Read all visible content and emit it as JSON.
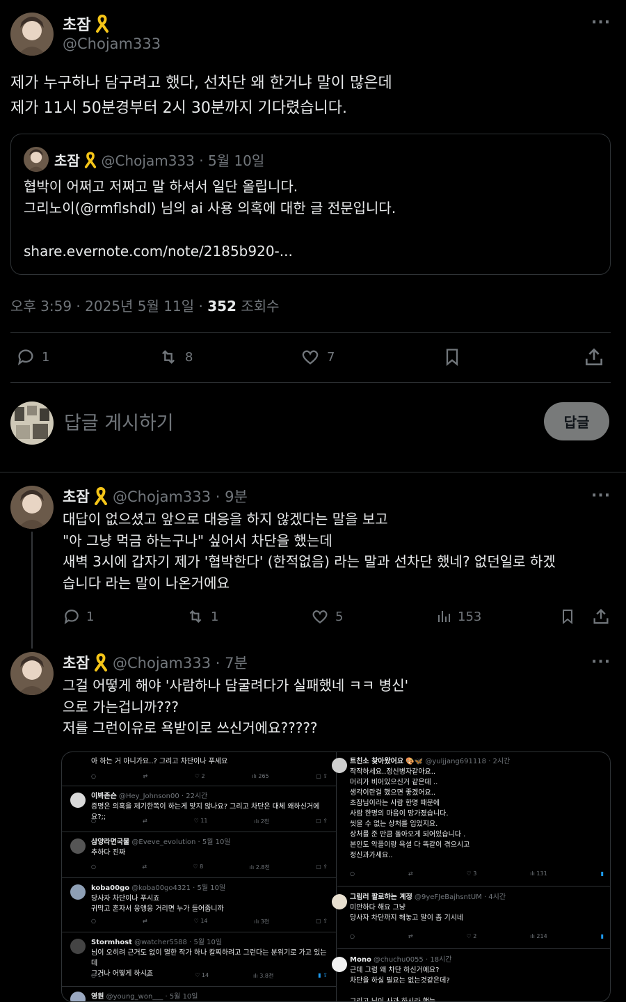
{
  "main_tweet": {
    "display_name": "초잠",
    "handle": "@Chojam333",
    "text_lines": [
      "제가 누구하나 담구려고 했다, 선차단 왜 한거냐 말이 많은데",
      "제가 11시 50분경부터 2시 30분까지 기다렸습니다."
    ],
    "quote": {
      "display_name": "초잠",
      "handle": "@Chojam333",
      "date": "· 5월 10일",
      "text_lines": [
        "협박이 어쩌고 저쩌고 말 하셔서 일단 올립니다.",
        "그리노이(@rmflshdl) 님의 ai 사용 의혹에 대한 글 전문입니다."
      ],
      "link": "share.evernote.com/note/2185b920-..."
    },
    "timestamp": "오후 3:59 · 2025년 5월 11일 ·",
    "views_count": "352",
    "views_label": "조회수",
    "stats": {
      "replies": "1",
      "reposts": "8",
      "likes": "7"
    }
  },
  "reply_box": {
    "placeholder": "답글 게시하기",
    "button": "답글"
  },
  "replies": [
    {
      "display_name": "초잠",
      "handle": "@Chojam333",
      "time": "· 9분",
      "text_lines": [
        "대답이 없으셨고 앞으로 대응을 하지 않겠다는 말을 보고",
        "\"아 그냥 먹금 하는구나\" 싶어서 차단을 했는데",
        "새벽 3시에 갑자기 제가 '협박한다' (한적없음)  라는 말과 선차단 했네? 없던일로 하겠",
        "습니다 라는 말이 나온거에요"
      ],
      "stats": {
        "replies": "1",
        "reposts": "1",
        "likes": "5",
        "views": "153"
      }
    },
    {
      "display_name": "초잠",
      "handle": "@Chojam333",
      "time": "· 7분",
      "text_lines": [
        "그걸 어떻게 해야 '사람하나 담굴려다가 실패했네 ㅋㅋ 병신'",
        "으로 가는겁니까???",
        "저를 그런이유로 욕받이로 쓰신거에요?????"
      ]
    }
  ],
  "embedded": {
    "left": [
      {
        "name": "",
        "handle": "",
        "lines": [
          "아 하는 거 아니가요..? 그리고 차단이나 푸세요"
        ],
        "likes": "2",
        "views": "265"
      },
      {
        "name": "이봐존슨",
        "handle": "@Hey_Johnson00 · 22시간",
        "lines": [
          "증명은 의혹을 제기한쪽이 하는게 맞지 않나요? 그리고 차단은 대체 왜하신거에요?;;"
        ],
        "likes": "11",
        "views": "2천"
      },
      {
        "name": "삼양라면국물",
        "handle": "@Eveve_evolution · 5월 10일",
        "lines": [
          "추하다 진짜"
        ],
        "likes": "8",
        "views": "2.8천"
      },
      {
        "name": "koba00go",
        "handle": "@koba00go4321 · 5월 10일",
        "lines": [
          "당사자 차단이나 푸시죠",
          "귀막고 혼자서 웅앵웅 거리면 누가 들어줍니까"
        ],
        "likes": "14",
        "views": "3천"
      },
      {
        "name": "Stormhost",
        "handle": "@watcher5588 · 5월 10일",
        "lines": [
          "님이 오히려 근거도 없이 멀한 작가 하나 칼찌하려고 그런다는 분위기로 가고 있는데",
          "그거나 어떻게 하시죠"
        ],
        "replies": "1",
        "likes": "14",
        "views": "3.8천"
      },
      {
        "name": "영원",
        "handle": "@young_won___ · 5월 10일",
        "lines": [],
        "likes": "",
        "views": ""
      }
    ],
    "right": [
      {
        "name": "트친소 찾아왔어요",
        "handle": "@yuljjang691118 · 2시간",
        "lines": [
          "작작하세요..정신병자같아요..",
          "머리가 비어있으신거 같은데 ..",
          "생각이란걸 했으면 좋겠어요..",
          "초잠님이라는 사람 한명 때문에",
          "사람 한명의 마음이 망가졌습니다.",
          "씻을 수 없는 상처를 입었지요.",
          "상처를 준 만큼 돌아오게 되어있습니다 .",
          "본인도 악플이랑 욕설 다 똑같이 겪으시고",
          "정신과가세요.."
        ],
        "likes": "3",
        "views": "131"
      },
      {
        "name": "그림러 팔로하는 계정",
        "handle": "@9yeFJeBajhsntUM · 4시간",
        "lines": [
          "미안하다 해요 그냥",
          "당사자 차단까지 해놓고 말이 좀 기시네"
        ],
        "likes": "2",
        "views": "214"
      },
      {
        "name": "Mono",
        "handle": "@chuchu0055 · 18시간",
        "lines": [
          "근데 그럼 왜 차단 하신거에요?",
          "차단을 하실 필요는 없는것같은데?",
          "",
          "그리고 님이 사과 하시라 했는"
        ],
        "likes": "",
        "views": ""
      }
    ]
  },
  "colors": {
    "background": "#000000",
    "text": "#e7e9ea",
    "muted": "#71767b",
    "border": "#2f3336",
    "ribbon": "#f5c518",
    "button_bg": "#787a7a"
  }
}
